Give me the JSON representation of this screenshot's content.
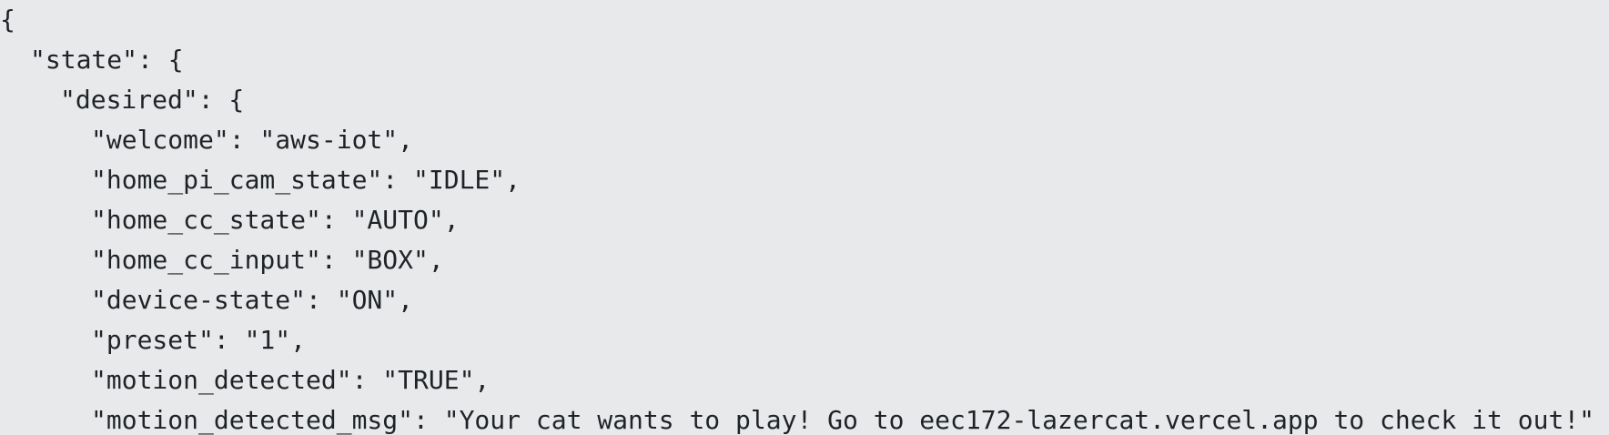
{
  "code": {
    "lines": [
      "{",
      "\"state\": {",
      "\"desired\": {",
      "\"welcome\": \"aws-iot\",",
      "\"home_pi_cam_state\": \"IDLE\",",
      "\"home_cc_state\": \"AUTO\",",
      "\"home_cc_input\": \"BOX\",",
      "\"device-state\": \"ON\",",
      "\"preset\": \"1\",",
      "\"motion_detected\": \"TRUE\",",
      "\"motion_detected_msg\": \"Your cat wants to play! Go to eec172-lazercat.vercel.app to check it out!\""
    ]
  }
}
